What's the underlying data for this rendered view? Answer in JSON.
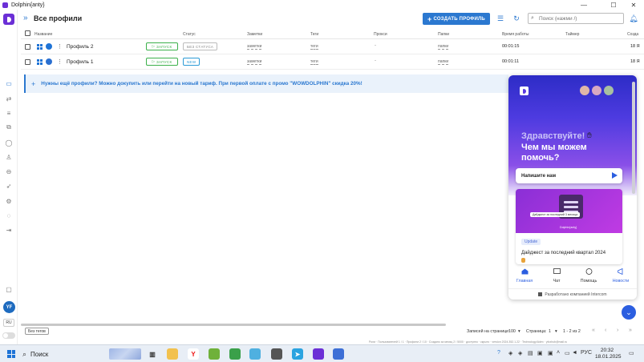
{
  "window": {
    "title": "Dolphin{anty}"
  },
  "header": {
    "title": "Все профили",
    "create_button": "СОЗДАТЬ ПРОФИЛЬ",
    "search_placeholder": "Поиск (нажми /)"
  },
  "table": {
    "columns": [
      "Название",
      "Статус",
      "Заметки",
      "Теги",
      "Прокси",
      "Папки",
      "Время работы",
      "Таймер",
      "Созда"
    ],
    "rows": [
      {
        "name": "Профиль 2",
        "start": "ЗАПУСК",
        "status": "БЕЗ СТАТУСА",
        "notes": "заметки",
        "tags": "теги",
        "proxy": "-",
        "folders": "папки",
        "uptime": "00:01:15",
        "created": "18 Я"
      },
      {
        "name": "Профиль 1",
        "start": "ЗАПУСК",
        "status": "NEW",
        "notes": "заметки",
        "tags": "теги",
        "proxy": "-",
        "folders": "папки",
        "uptime": "00:01:11",
        "created": "18 Я"
      }
    ]
  },
  "banner": {
    "text": "Нужны ещё профили? Можно докупить или перейти на новый тариф. При первой оплате с промо \"WOWDOLPHIN\" скидка 20%!"
  },
  "sidebar": {
    "avatar_initials": "YF",
    "language": "RU"
  },
  "intercom": {
    "greeting": "Здравствуйте!",
    "question_line1": "Чем мы можем",
    "question_line2": "помочь?",
    "message_prompt": "Напишите нам",
    "card_caption": "Дайджест за последний 3 месяца",
    "card_brand": "Dolphin{anty}",
    "card_badge": "Update",
    "card_title": "Дайджест за последний квартал 2024",
    "nav": [
      "Главная",
      "Чат",
      "Помощь",
      "Новости"
    ],
    "footer": "Разработано компанией Intercom"
  },
  "footer": {
    "no_tags_button": "Без тегов",
    "rows_per_page_label": "Записей на странице:",
    "rows_per_page_value": "100",
    "page_label": "Страница:",
    "page_value": "1",
    "range": "1 - 2 из 2",
    "statusline": "Роли · Пользователей 1 / 1 · Профили 2 / 10 · Создано за месяц 2 / 5000 · доступно · скрыто · version 2024.352.1.22 · Technology/Adex · yfoxhub@mail.ru"
  },
  "taskbar": {
    "search_label": "Поиск",
    "lang": "РУС",
    "time": "20:32",
    "date": "18.01.2025"
  },
  "colors": {
    "accent": "#2b78d0",
    "brand": "#6b2fd6",
    "start_green": "#3bb04a",
    "intercom": "#2b5ee0"
  }
}
